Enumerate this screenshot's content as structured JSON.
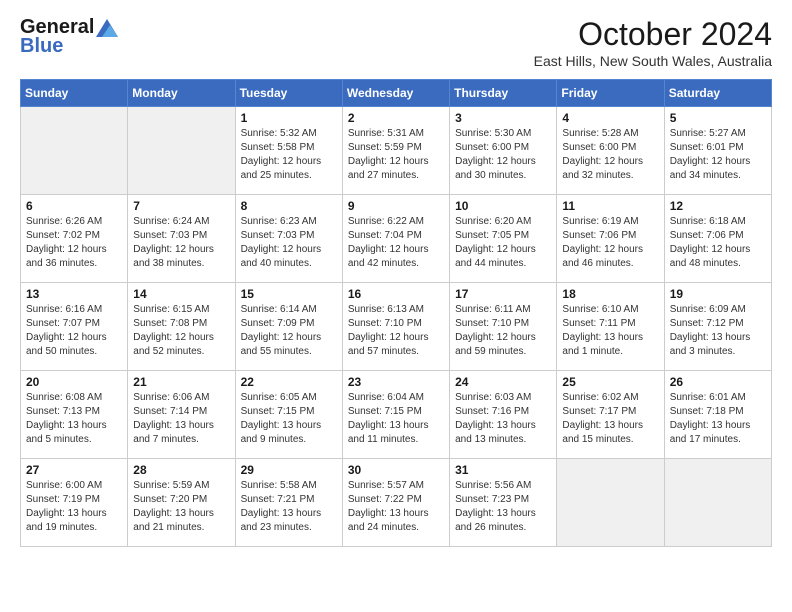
{
  "header": {
    "logo_general": "General",
    "logo_blue": "Blue",
    "month": "October 2024",
    "location": "East Hills, New South Wales, Australia"
  },
  "days_of_week": [
    "Sunday",
    "Monday",
    "Tuesday",
    "Wednesday",
    "Thursday",
    "Friday",
    "Saturday"
  ],
  "weeks": [
    [
      {
        "day": "",
        "info": ""
      },
      {
        "day": "",
        "info": ""
      },
      {
        "day": "1",
        "info": "Sunrise: 5:32 AM\nSunset: 5:58 PM\nDaylight: 12 hours\nand 25 minutes."
      },
      {
        "day": "2",
        "info": "Sunrise: 5:31 AM\nSunset: 5:59 PM\nDaylight: 12 hours\nand 27 minutes."
      },
      {
        "day": "3",
        "info": "Sunrise: 5:30 AM\nSunset: 6:00 PM\nDaylight: 12 hours\nand 30 minutes."
      },
      {
        "day": "4",
        "info": "Sunrise: 5:28 AM\nSunset: 6:00 PM\nDaylight: 12 hours\nand 32 minutes."
      },
      {
        "day": "5",
        "info": "Sunrise: 5:27 AM\nSunset: 6:01 PM\nDaylight: 12 hours\nand 34 minutes."
      }
    ],
    [
      {
        "day": "6",
        "info": "Sunrise: 6:26 AM\nSunset: 7:02 PM\nDaylight: 12 hours\nand 36 minutes."
      },
      {
        "day": "7",
        "info": "Sunrise: 6:24 AM\nSunset: 7:03 PM\nDaylight: 12 hours\nand 38 minutes."
      },
      {
        "day": "8",
        "info": "Sunrise: 6:23 AM\nSunset: 7:03 PM\nDaylight: 12 hours\nand 40 minutes."
      },
      {
        "day": "9",
        "info": "Sunrise: 6:22 AM\nSunset: 7:04 PM\nDaylight: 12 hours\nand 42 minutes."
      },
      {
        "day": "10",
        "info": "Sunrise: 6:20 AM\nSunset: 7:05 PM\nDaylight: 12 hours\nand 44 minutes."
      },
      {
        "day": "11",
        "info": "Sunrise: 6:19 AM\nSunset: 7:06 PM\nDaylight: 12 hours\nand 46 minutes."
      },
      {
        "day": "12",
        "info": "Sunrise: 6:18 AM\nSunset: 7:06 PM\nDaylight: 12 hours\nand 48 minutes."
      }
    ],
    [
      {
        "day": "13",
        "info": "Sunrise: 6:16 AM\nSunset: 7:07 PM\nDaylight: 12 hours\nand 50 minutes."
      },
      {
        "day": "14",
        "info": "Sunrise: 6:15 AM\nSunset: 7:08 PM\nDaylight: 12 hours\nand 52 minutes."
      },
      {
        "day": "15",
        "info": "Sunrise: 6:14 AM\nSunset: 7:09 PM\nDaylight: 12 hours\nand 55 minutes."
      },
      {
        "day": "16",
        "info": "Sunrise: 6:13 AM\nSunset: 7:10 PM\nDaylight: 12 hours\nand 57 minutes."
      },
      {
        "day": "17",
        "info": "Sunrise: 6:11 AM\nSunset: 7:10 PM\nDaylight: 12 hours\nand 59 minutes."
      },
      {
        "day": "18",
        "info": "Sunrise: 6:10 AM\nSunset: 7:11 PM\nDaylight: 13 hours\nand 1 minute."
      },
      {
        "day": "19",
        "info": "Sunrise: 6:09 AM\nSunset: 7:12 PM\nDaylight: 13 hours\nand 3 minutes."
      }
    ],
    [
      {
        "day": "20",
        "info": "Sunrise: 6:08 AM\nSunset: 7:13 PM\nDaylight: 13 hours\nand 5 minutes."
      },
      {
        "day": "21",
        "info": "Sunrise: 6:06 AM\nSunset: 7:14 PM\nDaylight: 13 hours\nand 7 minutes."
      },
      {
        "day": "22",
        "info": "Sunrise: 6:05 AM\nSunset: 7:15 PM\nDaylight: 13 hours\nand 9 minutes."
      },
      {
        "day": "23",
        "info": "Sunrise: 6:04 AM\nSunset: 7:15 PM\nDaylight: 13 hours\nand 11 minutes."
      },
      {
        "day": "24",
        "info": "Sunrise: 6:03 AM\nSunset: 7:16 PM\nDaylight: 13 hours\nand 13 minutes."
      },
      {
        "day": "25",
        "info": "Sunrise: 6:02 AM\nSunset: 7:17 PM\nDaylight: 13 hours\nand 15 minutes."
      },
      {
        "day": "26",
        "info": "Sunrise: 6:01 AM\nSunset: 7:18 PM\nDaylight: 13 hours\nand 17 minutes."
      }
    ],
    [
      {
        "day": "27",
        "info": "Sunrise: 6:00 AM\nSunset: 7:19 PM\nDaylight: 13 hours\nand 19 minutes."
      },
      {
        "day": "28",
        "info": "Sunrise: 5:59 AM\nSunset: 7:20 PM\nDaylight: 13 hours\nand 21 minutes."
      },
      {
        "day": "29",
        "info": "Sunrise: 5:58 AM\nSunset: 7:21 PM\nDaylight: 13 hours\nand 23 minutes."
      },
      {
        "day": "30",
        "info": "Sunrise: 5:57 AM\nSunset: 7:22 PM\nDaylight: 13 hours\nand 24 minutes."
      },
      {
        "day": "31",
        "info": "Sunrise: 5:56 AM\nSunset: 7:23 PM\nDaylight: 13 hours\nand 26 minutes."
      },
      {
        "day": "",
        "info": ""
      },
      {
        "day": "",
        "info": ""
      }
    ]
  ]
}
